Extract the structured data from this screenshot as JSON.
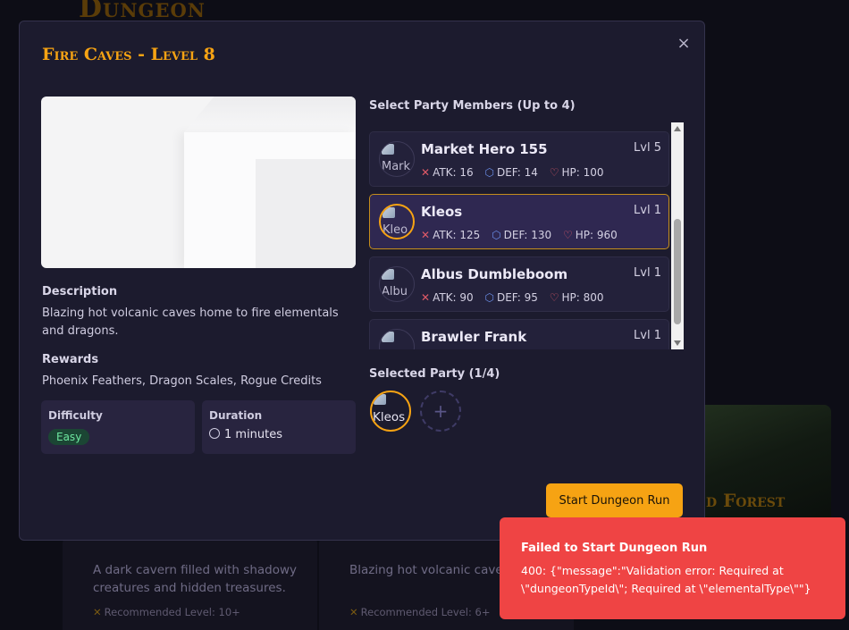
{
  "background": {
    "page_title": "Dungeon",
    "forest_title": "d Forest",
    "card1": {
      "description": "A dark cavern filled with shadowy creatures and hidden treasures.",
      "recommended": "Recommended Level: 10+"
    },
    "card2": {
      "description": "Blazing hot volcanic caves home to fire elementals and dragons.",
      "recommended": "Recommended Level: 6+"
    }
  },
  "modal": {
    "title": "Fire Caves - Level 8",
    "close_glyph": "×",
    "description_label": "Description",
    "description": "Blazing hot volcanic caves home to fire elementals and dragons.",
    "rewards_label": "Rewards",
    "rewards": "Phoenix Feathers, Dragon Scales, Rogue Credits",
    "difficulty_label": "Difficulty",
    "difficulty": "Easy",
    "duration_label": "Duration",
    "duration": "1 minutes",
    "party_heading": "Select Party Members (Up to 4)",
    "members": [
      {
        "name": "Market Hero 155",
        "avatar_alt": "Mark",
        "level": "Lvl 5",
        "atk": "ATK: 16",
        "def": "DEF: 14",
        "hp": "HP: 100",
        "selected": false
      },
      {
        "name": "Kleos",
        "avatar_alt": "Kleo",
        "level": "Lvl 1",
        "atk": "ATK: 125",
        "def": "DEF: 130",
        "hp": "HP: 960",
        "selected": true
      },
      {
        "name": "Albus Dumbleboom",
        "avatar_alt": "Albu",
        "level": "Lvl 1",
        "atk": "ATK: 90",
        "def": "DEF: 95",
        "hp": "HP: 800",
        "selected": false
      },
      {
        "name": "Brawler Frank",
        "avatar_alt": "",
        "level": "Lvl 1",
        "atk": "",
        "def": "",
        "hp": "",
        "selected": false
      }
    ],
    "selected_heading": "Selected Party (1/4)",
    "selected_party": [
      {
        "avatar_alt": "Kleos"
      }
    ],
    "add_glyph": "+",
    "start_button": "Start Dungeon Run"
  },
  "toast": {
    "title": "Failed to Start Dungeon Run",
    "message": "400: {\"message\":\"Validation error: Required at \\\"dungeonTypeId\\\"; Required at \\\"elementalType\\\"\"}"
  },
  "colors": {
    "accent": "#f6a313",
    "error": "#ef4444",
    "modal_bg": "#1c1b2e"
  }
}
